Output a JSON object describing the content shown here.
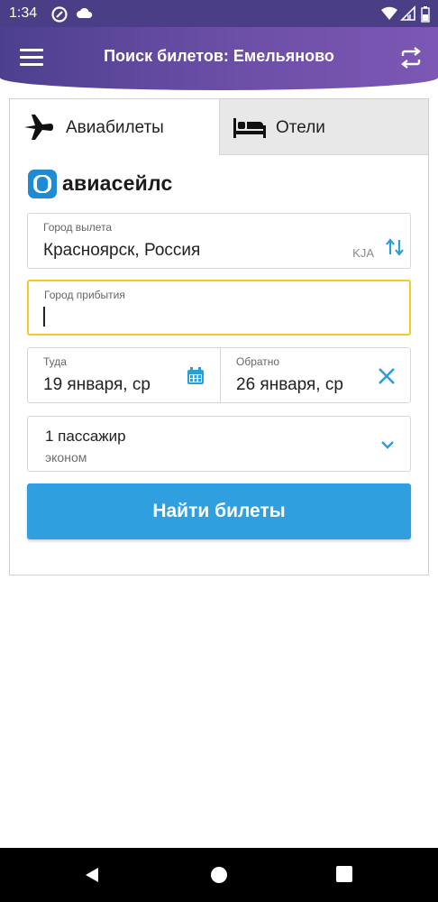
{
  "status_bar": {
    "time": "1:34",
    "icons": [
      "app-notification-icon",
      "cloud-icon",
      "wifi-icon",
      "signal-icon",
      "battery-icon"
    ]
  },
  "header": {
    "title": "Поиск билетов: Емельяново",
    "menu_icon": "hamburger-menu-icon",
    "action_icon": "swap-repeat-icon",
    "colors": {
      "gradient_start": "#4d3f8f",
      "gradient_end": "#7d57b4"
    }
  },
  "tabs": [
    {
      "label": "Авиабилеты",
      "icon": "airplane-icon",
      "active": true
    },
    {
      "label": "Отели",
      "icon": "bed-icon",
      "active": false
    }
  ],
  "brand": {
    "name": "авиасейлс",
    "logo_icon": "aviasales-logo"
  },
  "form": {
    "origin": {
      "label": "Город вылета",
      "value": "Красноярск, Россия",
      "code": "KJA"
    },
    "destination": {
      "label": "Город прибытия",
      "value": ""
    },
    "depart": {
      "label": "Туда",
      "value": "19 января, ср"
    },
    "return": {
      "label": "Обратно",
      "value": "26 января, ср"
    },
    "passengers": {
      "count_label": "1 пассажир",
      "class_label": "эконом"
    },
    "search_button": "Найти билеты"
  },
  "colors": {
    "accent": "#2f9fdf",
    "focus_border": "#f1cb2c",
    "icon_blue": "#2b9ed8"
  }
}
